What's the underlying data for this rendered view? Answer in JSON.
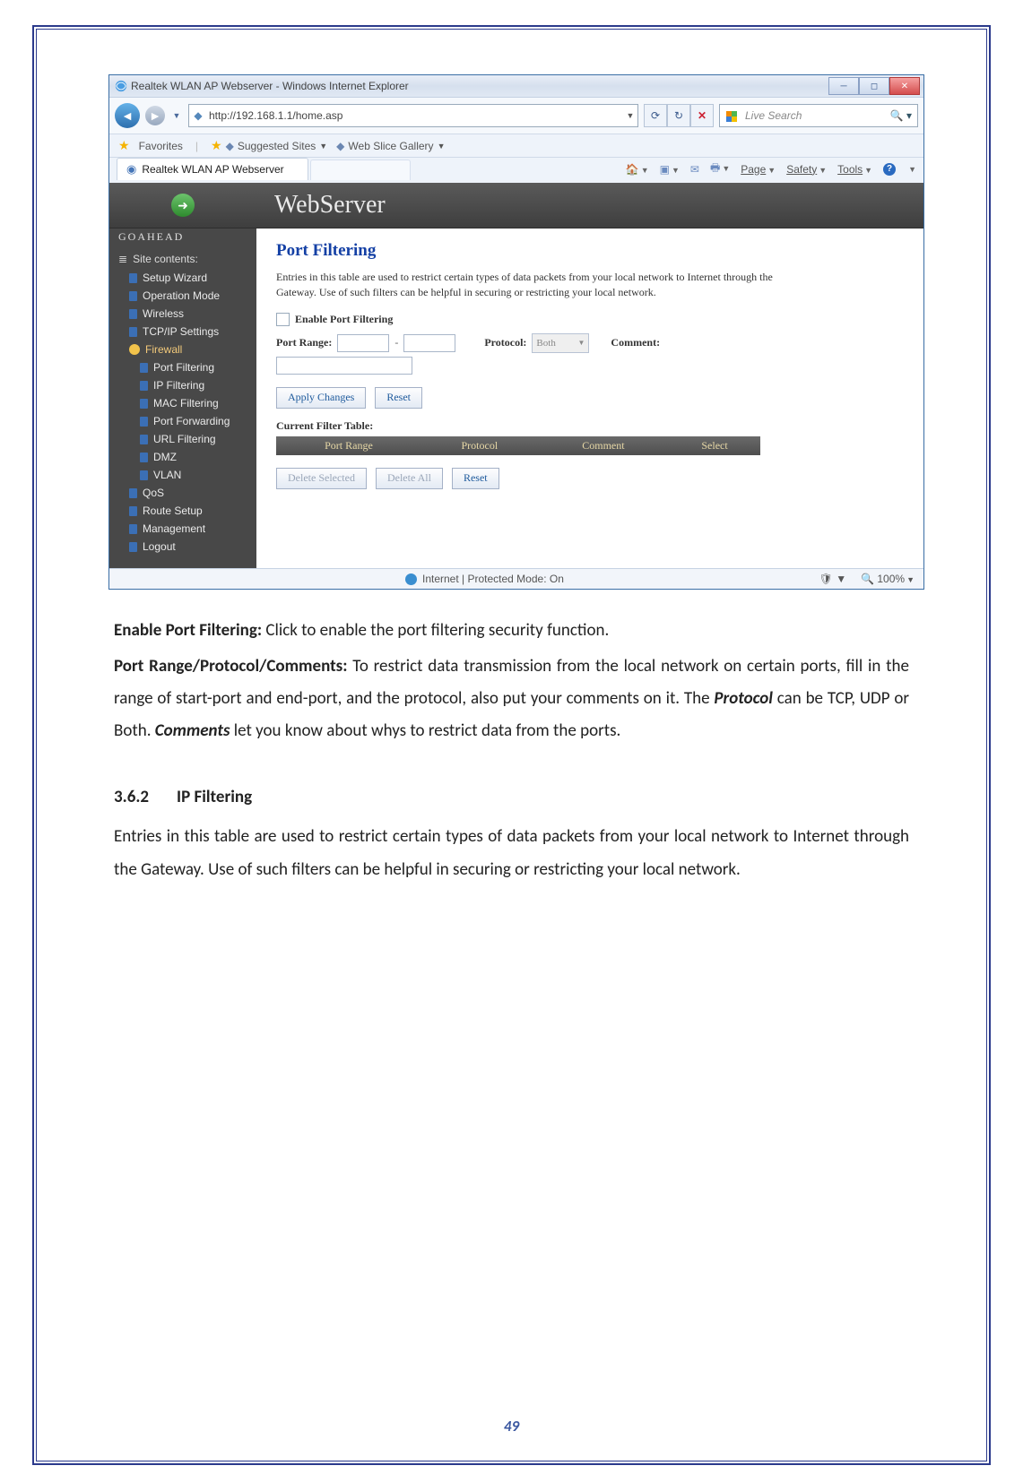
{
  "ie": {
    "window_title": "Realtek WLAN AP Webserver - Windows Internet Explorer",
    "url": "http://192.168.1.1/home.asp",
    "search_placeholder": "Live Search",
    "favbar": {
      "favorites": "Favorites",
      "suggested": "Suggested Sites",
      "gallery": "Web Slice Gallery"
    },
    "tab_title": "Realtek WLAN AP Webserver",
    "cmdbar": {
      "page": "Page",
      "safety": "Safety",
      "tools": "Tools"
    },
    "status": {
      "zone": "Internet | Protected Mode: On",
      "zoom": "100%"
    }
  },
  "side": {
    "brand": "GOAHEAD",
    "head": "Site contents:",
    "items": [
      "Setup Wizard",
      "Operation Mode",
      "Wireless",
      "TCP/IP Settings",
      "Firewall"
    ],
    "subs": [
      "Port Filtering",
      "IP Filtering",
      "MAC Filtering",
      "Port Forwarding",
      "URL Filtering",
      "DMZ",
      "VLAN"
    ],
    "tail": [
      "QoS",
      "Route Setup",
      "Management",
      "Logout"
    ]
  },
  "main": {
    "webserver": "WebServer",
    "title": "Port Filtering",
    "desc": "Entries in this table are used to restrict certain types of data packets from your local network to Internet through the Gateway. Use of such filters can be helpful in securing or restricting your local network.",
    "enable": "Enable Port Filtering",
    "port_range": "Port Range:",
    "protocol": "Protocol:",
    "protocol_value": "Both",
    "comment": "Comment:",
    "apply": "Apply Changes",
    "reset": "Reset",
    "table_label": "Current Filter Table:",
    "th": {
      "pr": "Port Range",
      "proto": "Protocol",
      "comment": "Comment",
      "select": "Select"
    },
    "del_sel": "Delete Selected",
    "del_all": "Delete All"
  },
  "doc": {
    "p1_lead": "Enable Port Filtering: ",
    "p1_body": "Click to enable the port filtering security function.",
    "p2_lead": "Port Range/Protocol/Comments: ",
    "p2_a": "To restrict data transmission from the local network on certain ports, fill in the range of start-port and end-port, and the protocol, also put your comments on it. The ",
    "p2_proto": "Protocol",
    "p2_b": " can be TCP, UDP or Both. ",
    "p2_comm": "Comments",
    "p2_c": " let you know about whys to restrict data from the ports.",
    "h_num": "3.6.2",
    "h_title": "IP Filtering",
    "p3": "Entries in this table are used to restrict certain types of data packets from your local network to Internet through the Gateway. Use of such filters can be helpful in securing or restricting your local network."
  },
  "page_number": "49"
}
